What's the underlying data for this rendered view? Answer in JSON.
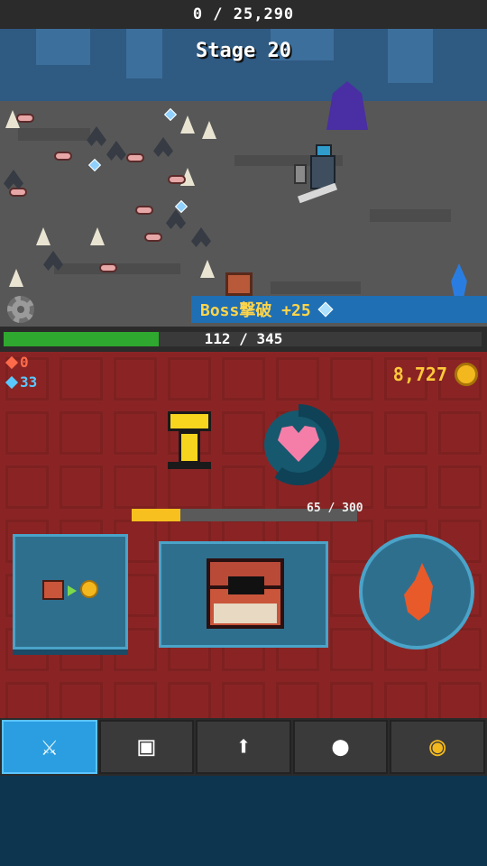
{
  "top": {
    "counter": "0 / 25,290"
  },
  "battle": {
    "stage_title": "Stage 20",
    "boss_banner": "Boss撃破 +25"
  },
  "hp": {
    "text": "112 / 345",
    "fraction": 0.325
  },
  "panel": {
    "red_stat": "0",
    "blue_stat": "33",
    "gold": "8,727",
    "heart_fraction": 0.6,
    "xp": {
      "text": "65 / 300",
      "fraction": 0.2167
    }
  },
  "colors": {
    "hp_green": "#2ea82e",
    "xp_yellow": "#f7c01e",
    "panel_red": "#8a2424",
    "nav_active": "#2a9ee0"
  },
  "nav": {
    "items": [
      {
        "icon": "crossed-swords-icon"
      },
      {
        "icon": "box-icon"
      },
      {
        "icon": "up-arrow-icon"
      },
      {
        "icon": "keyhole-icon"
      },
      {
        "icon": "coin-icon"
      }
    ],
    "active_index": 0
  }
}
